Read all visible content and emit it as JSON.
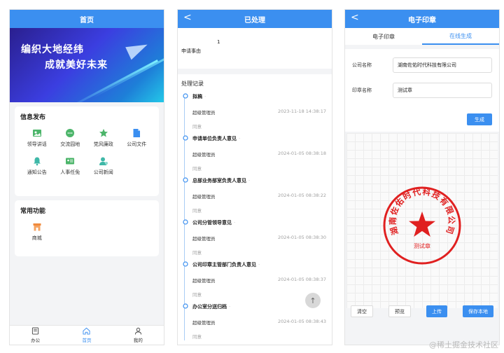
{
  "screen1": {
    "title": "首页",
    "banner": {
      "line1": "编织大地经纬",
      "line2": "成就美好未来"
    },
    "info_card": {
      "title": "信息发布",
      "items": [
        {
          "label": "领导讲话",
          "icon": "image-icon"
        },
        {
          "label": "交流园地",
          "icon": "chat-icon"
        },
        {
          "label": "党风廉政",
          "icon": "star-icon"
        },
        {
          "label": "公司文件",
          "icon": "document-icon"
        },
        {
          "label": "通知公告",
          "icon": "bell-icon"
        },
        {
          "label": "人事任免",
          "icon": "id-card-icon"
        },
        {
          "label": "公司新闻",
          "icon": "user-icon"
        }
      ]
    },
    "common_card": {
      "title": "常用功能",
      "items": [
        {
          "label": "商城",
          "icon": "shop-icon"
        }
      ]
    },
    "tabbar": [
      {
        "label": "办公",
        "icon": "office-icon"
      },
      {
        "label": "首页",
        "icon": "home-icon",
        "active": true
      },
      {
        "label": "我的",
        "icon": "profile-icon"
      }
    ]
  },
  "screen2": {
    "title": "已处理",
    "back": "<",
    "item_number": "1",
    "item_label": "申请事由",
    "records_title": "处理记录",
    "records": [
      {
        "title": "拟稿",
        "user": "超级管理员",
        "time": "2023-11-18 14:38:17",
        "opinion": "同意"
      },
      {
        "title": "申请单位负责人意见",
        "user": "超级管理员",
        "time": "2024-01-05 08:38:18",
        "opinion": "同意"
      },
      {
        "title": "总部业务部室负责人意见",
        "user": "超级管理员",
        "time": "2024-01-05 08:38:22",
        "opinion": "同意"
      },
      {
        "title": "公司分管领导意见",
        "user": "超级管理员",
        "time": "2024-01-05 08:38:30",
        "opinion": "同意"
      },
      {
        "title": "公司印章主管部门负责人意见",
        "user": "超级管理员",
        "time": "2024-01-05 08:38:37",
        "opinion": "同意"
      },
      {
        "title": "办公室分送归档",
        "user": "超级管理员",
        "time": "2024-01-05 08:38:43",
        "opinion": "同意"
      }
    ],
    "fab": "↑"
  },
  "screen3": {
    "title": "电子印章",
    "back": "<",
    "tabs": [
      {
        "label": "电子印章"
      },
      {
        "label": "在线生成",
        "active": true
      }
    ],
    "company_label": "公司名称",
    "company_value": "湖南佐佑时代科技有限公司",
    "seal_name_label": "印章名称",
    "seal_name_value": "测试章",
    "generate_button": "生成",
    "seal": {
      "ring_text": "湖南佐佑时代科技有限公司",
      "center_text": "测试章",
      "color": "#e02020"
    },
    "buttons": {
      "clear": "清空",
      "preview": "预览",
      "upload": "上传",
      "save": "保存本地"
    }
  },
  "watermark": "@稀土掘金技术社区",
  "colors": {
    "accent": "#3b8ff0",
    "seal": "#e02020"
  }
}
